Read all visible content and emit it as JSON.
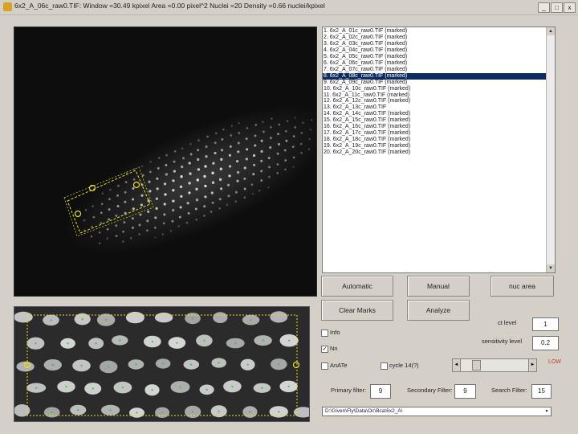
{
  "titlebar": {
    "title": "6x2_A_06c_raw0.TIF: Window =30.49 kpixel Area =0.00 pixel^2 Nuclei =20 Density =0.66 nuclei/kpixel",
    "minimize": "_",
    "maximize": "□",
    "close": "x"
  },
  "file_list": {
    "items": [
      "1. 6x2_A_01c_raw0.TIF (marked)",
      "2. 6x2_A_02c_raw0.TIF (marked)",
      "3. 6x2_A_03c_raw0.TIF (marked)",
      "4. 6x2_A_04c_raw0.TIF (marked)",
      "5. 6x2_A_05c_raw0.TIF (marked)",
      "6. 6x2_A_06c_raw0.TIF (marked)",
      "7. 6x2_A_07c_raw0.TIF (marked)",
      "8. 6x2_A_08c_raw0.TIF (marked)",
      "9. 6x2_A_09c_raw0.TIF (marked)",
      "10. 6x2_A_10c_raw0.TIF (marked)",
      "11. 6x2_A_11c_raw0.TIF (marked)",
      "12. 6x2_A_12c_raw0.TIF (marked)",
      "13. 6x2_A_13c_raw0.TIF",
      "14. 6x2_A_14c_raw0.TIF (marked)",
      "15. 6x2_A_15c_raw0.TIF (marked)",
      "16. 6x2_A_16c_raw0.TIF (marked)",
      "17. 6x2_A_17c_raw0.TIF (marked)",
      "18. 6x2_A_18c_raw0.TIF (marked)",
      "19. 6x2_A_19c_raw0.TIF (marked)",
      "20. 6x2_A_20c_raw0.TIF (marked)"
    ],
    "selected_index": 7
  },
  "buttons": {
    "automatic": "Automatic",
    "manual": "Manual",
    "nuc_area": "nuc area",
    "clear_marks": "Clear Marks",
    "analyze": "Analyze"
  },
  "checkboxes": {
    "info_label": "Info",
    "info_checked": false,
    "nn_label": "Nn",
    "nn_checked": true,
    "analyze_label": "AnATe",
    "analyze_checked": false,
    "cycle_label": "cycle 14(?)",
    "cycle_checked": false
  },
  "params": {
    "ct_level_label": "ct level",
    "ct_level_value": "1",
    "sensitivity_label": "sensitivity level",
    "sensitivity_value": "0.2",
    "low_label": "LOW",
    "primary_filter_label": "Primary filter:",
    "primary_filter_value": "9",
    "secondary_filter_label": "Secondary Filter:",
    "secondary_filter_value": "9",
    "search_filter_label": "Search Filter:",
    "search_filter_value": "15"
  },
  "path": {
    "value": "D:\\Given\\Fly\\Data\\Oc\\Bca\\6x2_A\\"
  },
  "icons": {
    "checkmark": "✓",
    "scroll_up": "▲",
    "scroll_down": "▼",
    "slider_left": "◄",
    "slider_right": "►",
    "dropdown": "▼"
  },
  "colors": {
    "selection": "#0b2a66",
    "marker": "#e7e21c",
    "low_text": "#c0392b"
  }
}
